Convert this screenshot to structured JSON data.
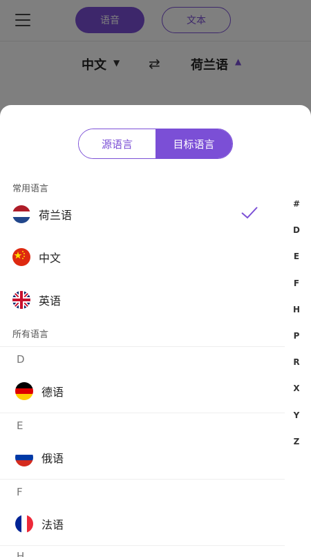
{
  "topbar": {
    "voice_label": "语音",
    "text_label": "文本"
  },
  "lang_bar": {
    "source": "中文",
    "target": "荷兰语"
  },
  "sheet": {
    "segment": {
      "source_label": "源语言",
      "target_label": "目标语言",
      "selected": "目标语言"
    },
    "common_title": "常用语言",
    "common": [
      {
        "label": "荷兰语",
        "flag": "netherlands-flag",
        "selected": true
      },
      {
        "label": "中文",
        "flag": "china-flag",
        "selected": false
      },
      {
        "label": "英语",
        "flag": "uk-flag",
        "selected": false
      }
    ],
    "all_title": "所有语言",
    "groups": [
      {
        "letter": "D",
        "items": [
          {
            "label": "德语",
            "flag": "germany-flag"
          }
        ]
      },
      {
        "letter": "E",
        "items": [
          {
            "label": "俄语",
            "flag": "russia-flag"
          }
        ]
      },
      {
        "letter": "F",
        "items": [
          {
            "label": "法语",
            "flag": "france-flag"
          }
        ]
      },
      {
        "letter": "H",
        "items": []
      }
    ],
    "index": [
      "#",
      "D",
      "E",
      "F",
      "H",
      "P",
      "R",
      "X",
      "Y",
      "Z"
    ]
  },
  "colors": {
    "accent": "#7b4fd6"
  }
}
